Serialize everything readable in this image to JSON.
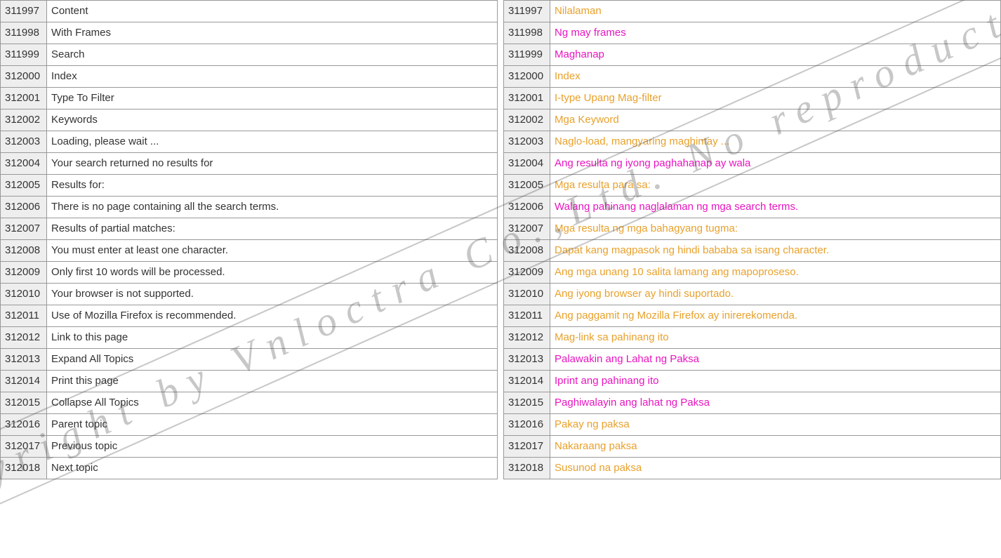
{
  "watermark_text": "Copyright by Vnloctra Co.,Ltd. No reproduction.",
  "rows": [
    {
      "id": "311997",
      "src": "Content",
      "dst": "Nilalaman",
      "color": "orange"
    },
    {
      "id": "311998",
      "src": "With Frames",
      "dst": "Ng may frames",
      "color": "magenta"
    },
    {
      "id": "311999",
      "src": "Search",
      "dst": "Maghanap",
      "color": "magenta"
    },
    {
      "id": "312000",
      "src": "Index",
      "dst": "Index",
      "color": "orange"
    },
    {
      "id": "312001",
      "src": "Type To Filter",
      "dst": "I-type Upang Mag-filter",
      "color": "orange"
    },
    {
      "id": "312002",
      "src": "Keywords",
      "dst": "Mga Keyword",
      "color": "orange"
    },
    {
      "id": "312003",
      "src": "Loading, please wait ...",
      "dst": "Naglo-load, mangyaring maghintay ...",
      "color": "orange"
    },
    {
      "id": "312004",
      "src": "Your search returned no results for",
      "dst": "Ang resulta ng iyong paghahanap ay wala",
      "color": "magenta"
    },
    {
      "id": "312005",
      "src": "Results for:",
      "dst": "Mga resulta para sa:",
      "color": "orange"
    },
    {
      "id": "312006",
      "src": "There is no page containing all the search terms.",
      "dst": "Walang pahinang naglalaman ng mga search terms.",
      "color": "magenta"
    },
    {
      "id": "312007",
      "src": "Results of partial matches:",
      "dst": "Mga resulta ng mga bahagyang tugma:",
      "color": "orange"
    },
    {
      "id": "312008",
      "src": "You must enter at least one character.",
      "dst": "Dapat kang magpasok ng hindi bababa sa isang character.",
      "color": "orange"
    },
    {
      "id": "312009",
      "src": "Only first 10 words will be processed.",
      "dst": "Ang mga unang 10 salita lamang ang mapoproseso.",
      "color": "orange"
    },
    {
      "id": "312010",
      "src": "Your browser is not supported.",
      "dst": "Ang iyong browser ay hindi suportado.",
      "color": "orange"
    },
    {
      "id": "312011",
      "src": "Use of Mozilla Firefox is recommended.",
      "dst": "Ang paggamit ng Mozilla Firefox ay inirerekomenda.",
      "color": "orange"
    },
    {
      "id": "312012",
      "src": "Link to this page",
      "dst": "Mag-link sa pahinang ito",
      "color": "orange"
    },
    {
      "id": "312013",
      "src": "Expand All Topics",
      "dst": "Palawakin ang Lahat ng Paksa",
      "color": "magenta"
    },
    {
      "id": "312014",
      "src": "Print this page",
      "dst": "Iprint ang pahinang ito",
      "color": "magenta"
    },
    {
      "id": "312015",
      "src": "Collapse All Topics",
      "dst": "Paghiwalayin ang lahat ng Paksa",
      "color": "magenta"
    },
    {
      "id": "312016",
      "src": "Parent topic",
      "dst": "Pakay ng paksa",
      "color": "orange"
    },
    {
      "id": "312017",
      "src": "Previous topic",
      "dst": "Nakaraang paksa",
      "color": "orange"
    },
    {
      "id": "312018",
      "src": "Next topic",
      "dst": "Susunod na paksa",
      "color": "orange"
    }
  ]
}
